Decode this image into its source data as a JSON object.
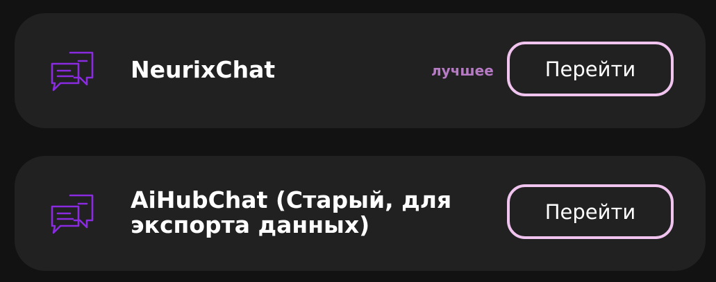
{
  "items": [
    {
      "title": "NeurixChat",
      "badge": "лучшее",
      "button_label": "Перейти",
      "icon": "chat-bubbles-icon"
    },
    {
      "title": "AiHubChat (Старый, для экспорта данных)",
      "badge": "",
      "button_label": "Перейти",
      "icon": "chat-bubbles-icon"
    }
  ],
  "colors": {
    "page_background": "#121212",
    "card_background": "#212121",
    "icon_accent": "#8a2be2",
    "badge_text": "#b77ac4",
    "button_border": "#f0c4ef",
    "text": "#ffffff"
  }
}
